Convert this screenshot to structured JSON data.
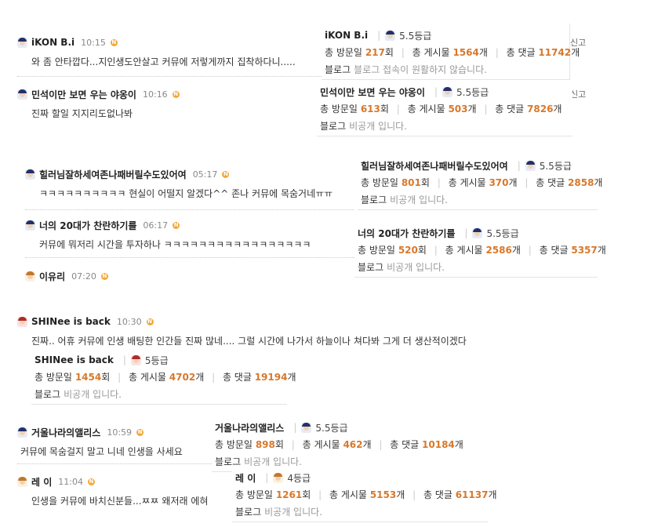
{
  "badge_letter": "N",
  "comments": [
    {
      "name": "iKON B.i",
      "time": "10:15",
      "text": "와 좀 안타깝다...지인생도안살고 커뮤에 저렇게까지 집착하다니.....",
      "avatar": "av-blue"
    },
    {
      "name": "민석이만 보면 우는 야옹이",
      "time": "10:16",
      "text": "진짜 할일 지지리도없나봐",
      "avatar": "av-blue"
    },
    {
      "name": "힐러님잘하세여존나패버릴수도있어여",
      "time": "05:17",
      "text": "ㅋㅋㅋㅋㅋㅋㅋㅋㅋㅋ 현실이 어떨지 알겠다^^ 존나 커뮤에 목숨거네ㅠㅠ",
      "avatar": "av-blue"
    },
    {
      "name": "너의 20대가 찬란하기를",
      "time": "06:17",
      "text": "커뮤에 뭐저리 시간을 투자하나 ㅋㅋㅋㅋㅋㅋㅋㅋㅋㅋㅋㅋㅋㅋㅋㅋㅋ",
      "avatar": "av-blue"
    },
    {
      "name": "이유리",
      "time": "07:20",
      "text": "",
      "avatar": "av-gold"
    },
    {
      "name": "SHINee is back",
      "time": "10:30",
      "text": "진짜.. 어휴 커뮤에 인생 배팅한 인간들 진짜 많네.... 그럴 시간에 나가서 하늘이나 쳐다봐 그게 더 생산적이겠다",
      "avatar": "av-red"
    },
    {
      "name": "거울나라의앨리스",
      "time": "10:59",
      "text": "커뮤에 목숨걸지 말고 니네 인생을 사세요",
      "avatar": "av-blue"
    },
    {
      "name": "레 이",
      "time": "11:04",
      "text": "인생을 커뮤에 바치신분들...ㅉㅉ 왜저래 에혀",
      "avatar": "av-gold"
    }
  ],
  "labels": {
    "visits": "총 방문일",
    "visits_unit": "회",
    "posts": "총 게시물",
    "posts_unit": "개",
    "replies": "총 댓글",
    "replies_unit": "개",
    "blog": "블로그"
  },
  "cards": [
    {
      "name": "iKON B.i",
      "grade": "5.5등급",
      "visits": "217",
      "posts": "1564",
      "replies": "11742",
      "blog_note": "블로그 접속이 원활하지 않습니다.",
      "avatar": "av-blue"
    },
    {
      "name": "민석이만 보면 우는 야옹이",
      "grade": "5.5등급",
      "visits": "613",
      "posts": "503",
      "replies": "7826",
      "blog_note": "비공개 입니다.",
      "avatar": "av-blue"
    },
    {
      "name": "힐러님잘하세여존나패버릴수도있어여",
      "grade": "5.5등급",
      "visits": "801",
      "posts": "370",
      "replies": "2858",
      "blog_note": "비공개 입니다.",
      "avatar": "av-blue"
    },
    {
      "name": "너의 20대가 찬란하기를",
      "grade": "5.5등급",
      "visits": "520",
      "posts": "2586",
      "replies": "5357",
      "blog_note": "비공개 입니다.",
      "avatar": "av-blue"
    },
    {
      "name": "SHINee is back",
      "grade": "5등급",
      "visits": "1454",
      "posts": "4702",
      "replies": "19194",
      "blog_note": "비공개 입니다.",
      "avatar": "av-red"
    },
    {
      "name": "거울나라의앨리스",
      "grade": "5.5등급",
      "visits": "898",
      "posts": "462",
      "replies": "10184",
      "blog_note": "비공개 입니다.",
      "avatar": "av-blue"
    },
    {
      "name": "레 이",
      "grade": "4등급",
      "visits": "1261",
      "posts": "5153",
      "replies": "61137",
      "blog_note": "비공개 입니다.",
      "avatar": "av-gold"
    }
  ],
  "edge": {
    "report": "신고"
  }
}
